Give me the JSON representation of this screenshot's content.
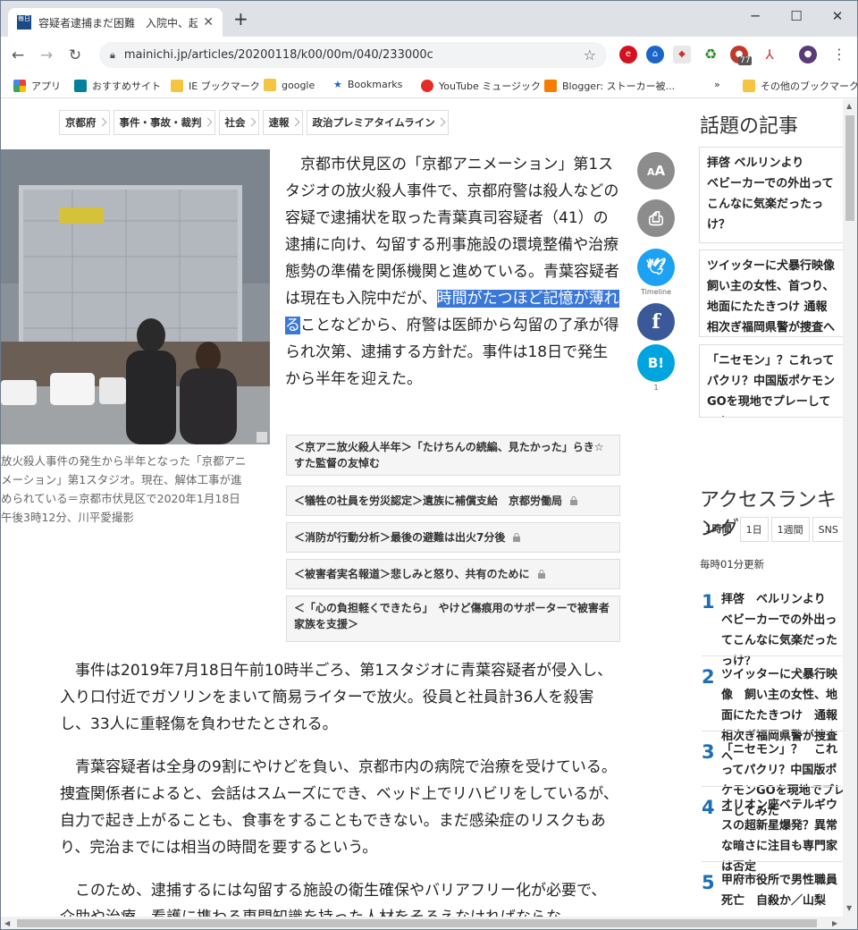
{
  "browser": {
    "tab_title": "容疑者逮捕まだ困難　入院中、起訴",
    "tab_favicon_text": "毎日",
    "url": "mainichi.jp/articles/20200118/k00/00m/040/233000c",
    "extension_badge": "77",
    "window_controls": {
      "minimize": "─",
      "maximize": "☐",
      "close": "✕"
    }
  },
  "bookmarks": [
    {
      "label": "アプリ",
      "icon": "apps-grid-icon"
    },
    {
      "label": "おすすめサイト",
      "icon": "bing-icon"
    },
    {
      "label": "IE ブックマーク",
      "icon": "folder-icon"
    },
    {
      "label": "google",
      "icon": "folder-icon"
    },
    {
      "label": "Bookmarks",
      "icon": "star-icon"
    },
    {
      "label": "YouTube ミュージック",
      "icon": "youtube-music-icon"
    },
    {
      "label": "Blogger: ストーカー被...",
      "icon": "blogger-icon"
    }
  ],
  "bookmarks_overflow": "»",
  "bookmarks_other": "その他のブックマーク",
  "breadcrumbs": [
    "京都府",
    "事件・事故・裁判",
    "社会",
    "速報",
    "政治プレミアタイムライン"
  ],
  "photo_caption": "放火殺人事件の発生から半年となった「京都アニメーション」第1スタジオ。現在、解体工事が進められている＝京都市伏見区で2020年1月18日午後3時12分、川平愛撮影",
  "lead": {
    "before": "京都市伏見区の「京都アニメーション」第1スタジオの放火殺人事件で、京都府警は殺人などの容疑で逮捕状を取った青葉真司容疑者（41）の逮捕に向け、勾留する刑事施設の環境整備や治療態勢の準備を関係機関と進めている。青葉容疑者は現在も入院中だが、",
    "highlight": "時間がたつほど記憶が薄れる",
    "after": "ことなどから、府警は医師から勾留の了承が得られ次第、逮捕する方針だ。事件は18日で発生から半年を迎えた。"
  },
  "share": {
    "font_size": "A",
    "print": "⎙",
    "twitter_label": "Timeline",
    "facebook": "f",
    "hatena": "B!",
    "hatena_count": "1"
  },
  "related": [
    {
      "text": "＜京アニ放火殺人半年＞「たけちんの続編、見たかった」らき☆すた監督の友悼む",
      "locked": false
    },
    {
      "text": "＜犠牲の社員を労災認定＞遺族に補償支給　京都労働局",
      "locked": true
    },
    {
      "text": "＜消防が行動分析＞最後の避難は出火7分後",
      "locked": true
    },
    {
      "text": "＜被害者実名報道＞悲しみと怒り、共有のために",
      "locked": true
    },
    {
      "text": "＜「心の負担軽くできたら」　やけど傷痕用のサポーターで被害者家族を支援＞",
      "locked": false
    }
  ],
  "body": [
    "事件は2019年7月18日午前10時半ごろ、第1スタジオに青葉容疑者が侵入し、入り口付近でガソリンをまいて簡易ライターで放火。役員と社員計36人を殺害し、33人に重軽傷を負わせたとされる。",
    "青葉容疑者は全身の9割にやけどを負い、京都市内の病院で治療を受けている。捜査関係者によると、会話はスムーズにでき、ベッド上でリハビリをしているが、自力で起き上がることも、食事をすることもできない。まだ感染症のリスクもあり、完治までには相当の時間を要するという。",
    "このため、逮捕するには勾留する施設の衛生確保やバリアフリー化が必要で、介助や治療、看護に携わる専門知識を持った人材をそろえなければならな"
  ],
  "sidebar": {
    "topics_title": "話題の記事",
    "topics": [
      {
        "head": "拝啓 ベルリンより",
        "title": "ベビーカーでの外出ってこんなに気楽だったっけ？",
        "locked": false
      },
      {
        "head": "",
        "title": "ツイッターに犬暴行映像　飼い主の女性、首つり、地面にたたきつけ 通報相次ぎ福岡県警が捜査へ",
        "locked": true
      },
      {
        "head": "",
        "title": "「ニセモン」？これってパクリ？中国版ポケモンGOを現地でプレーしてみた",
        "locked": true
      }
    ],
    "ranking_title": "アクセスランキング",
    "ranking_tabs": [
      "1時間",
      "1日",
      "1週間",
      "SNS"
    ],
    "updated": "毎時01分更新",
    "ranking": [
      {
        "num": "1",
        "title": "拝啓　ベルリンより　ベビーカーでの外出ってこんなに気楽だったっけ？"
      },
      {
        "num": "2",
        "title": "ツイッターに犬暴行映像　飼い主の女性、地面にたたきつけ　通報相次ぎ福岡県警が捜査へ"
      },
      {
        "num": "3",
        "title": "「ニセモン」？　これってパクリ？中国版ポケモンGOを現地でプレーしてみた"
      },
      {
        "num": "4",
        "title": "オリオン座ベテルギウスの超新星爆発？異常な暗さに注目も専門家は否定"
      },
      {
        "num": "5",
        "title": "甲府市役所で男性職員死亡　自殺か／山梨"
      }
    ]
  }
}
